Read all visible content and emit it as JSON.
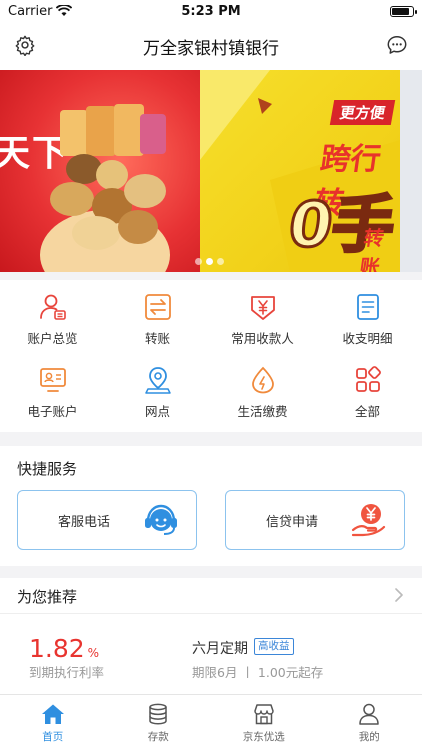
{
  "status_bar": {
    "carrier": "Carrier",
    "time": "5:23 PM",
    "battery_level": 0.85
  },
  "nav": {
    "title": "万全家银村镇银行",
    "left_icon": "gear-icon",
    "right_icon": "chat-icon"
  },
  "banner": {
    "slide1_text": "天下",
    "slide2_tag": "更方便",
    "slide2_headline": "跨行转",
    "slide2_zero": "0手",
    "slide2_sub": "转账",
    "active_dot": 1,
    "dot_count": 3
  },
  "menu": {
    "items": [
      {
        "label": "账户总览",
        "icon": "account-overview-icon"
      },
      {
        "label": "转账",
        "icon": "transfer-icon"
      },
      {
        "label": "常用收款人",
        "icon": "payee-icon"
      },
      {
        "label": "收支明细",
        "icon": "statement-icon"
      },
      {
        "label": "电子账户",
        "icon": "e-account-icon"
      },
      {
        "label": "网点",
        "icon": "location-icon"
      },
      {
        "label": "生活缴费",
        "icon": "utility-icon"
      },
      {
        "label": "全部",
        "icon": "all-apps-icon"
      }
    ]
  },
  "quick": {
    "title": "快捷服务",
    "cards": [
      {
        "label": "客服电话",
        "icon": "customer-service-icon"
      },
      {
        "label": "信贷申请",
        "icon": "loan-icon"
      }
    ]
  },
  "recommend": {
    "title": "为您推荐",
    "rate": "1.82",
    "rate_unit": "%",
    "rate_label": "到期执行利率",
    "product_name": "六月定期",
    "badge": "高收益",
    "meta": "期限6月 丨 1.00元起存"
  },
  "tabbar": {
    "active": 0,
    "tabs": [
      {
        "label": "首页",
        "icon": "home-icon"
      },
      {
        "label": "存款",
        "icon": "deposit-icon"
      },
      {
        "label": "京东优选",
        "icon": "shop-icon"
      },
      {
        "label": "我的",
        "icon": "profile-icon"
      }
    ]
  },
  "colors": {
    "brand_blue": "#2f8fe0",
    "accent_red": "#e8342f",
    "accent_orange": "#f08a3c"
  }
}
